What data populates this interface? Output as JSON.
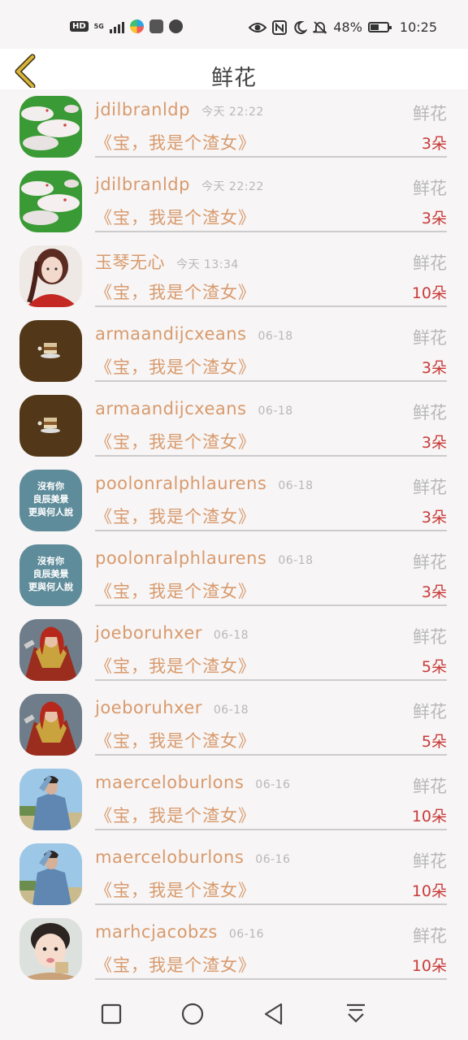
{
  "status_bar": {
    "left_badge": "HD",
    "network": "5G",
    "battery_level": 0.48,
    "battery_text": "48%",
    "time": "10:25",
    "icons": [
      "eye-icon",
      "nfc-icon",
      "moon-icon",
      "silent-bell-icon",
      "battery-icon"
    ]
  },
  "header": {
    "title": "鲜花",
    "back_icon": "chevron-left-icon",
    "accent_color": "#c9a227"
  },
  "rows": [
    {
      "name": "jdilbranldp",
      "time": "今天 22:22",
      "gift": "鲜花",
      "work": "《宝，我是个渣女》",
      "count": "3朵",
      "avatar": "rabbit"
    },
    {
      "name": "jdilbranldp",
      "time": "今天 22:22",
      "gift": "鲜花",
      "work": "《宝，我是个渣女》",
      "count": "3朵",
      "avatar": "rabbit"
    },
    {
      "name": "玉琴无心",
      "time": "今天 13:34",
      "gift": "鲜花",
      "work": "《宝，我是个渣女》",
      "count": "10朵",
      "avatar": "girl-red"
    },
    {
      "name": "armaandijcxeans",
      "time": "06-18",
      "gift": "鲜花",
      "work": "《宝，我是个渣女》",
      "count": "3朵",
      "avatar": "cake"
    },
    {
      "name": "armaandijcxeans",
      "time": "06-18",
      "gift": "鲜花",
      "work": "《宝，我是个渣女》",
      "count": "3朵",
      "avatar": "cake"
    },
    {
      "name": "poolonralphlaurens",
      "time": "06-18",
      "gift": "鲜花",
      "work": "《宝，我是个渣女》",
      "count": "3朵",
      "avatar": "text-blue"
    },
    {
      "name": "poolonralphlaurens",
      "time": "06-18",
      "gift": "鲜花",
      "work": "《宝，我是个渣女》",
      "count": "3朵",
      "avatar": "text-blue"
    },
    {
      "name": "joeboruhxer",
      "time": "06-18",
      "gift": "鲜花",
      "work": "《宝，我是个渣女》",
      "count": "5朵",
      "avatar": "warrior"
    },
    {
      "name": "joeboruhxer",
      "time": "06-18",
      "gift": "鲜花",
      "work": "《宝，我是个渣女》",
      "count": "5朵",
      "avatar": "warrior"
    },
    {
      "name": "maerceloburlons",
      "time": "06-16",
      "gift": "鲜花",
      "work": "《宝，我是个渣女》",
      "count": "10朵",
      "avatar": "denim-man"
    },
    {
      "name": "maerceloburlons",
      "time": "06-16",
      "gift": "鲜花",
      "work": "《宝，我是个渣女》",
      "count": "10朵",
      "avatar": "denim-man"
    },
    {
      "name": "marhcjacobzs",
      "time": "06-16",
      "gift": "鲜花",
      "work": "《宝，我是个渣女》",
      "count": "10朵",
      "avatar": "child"
    }
  ],
  "avatar_text": {
    "text-blue": [
      "沒有你",
      "良辰美景",
      "更與何人說"
    ]
  },
  "nav_bar": {
    "icons": [
      "square-icon",
      "circle-home-icon",
      "triangle-back-icon",
      "notification-pull-icon"
    ]
  }
}
